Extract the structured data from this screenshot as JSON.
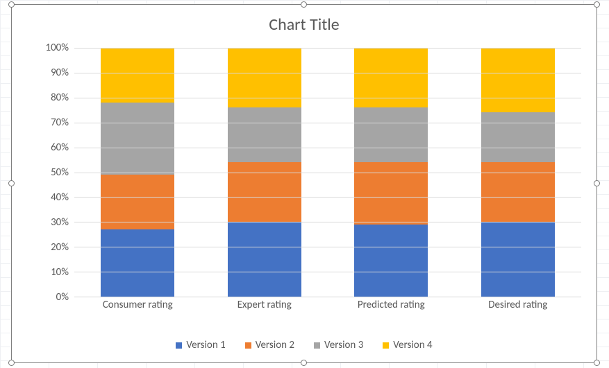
{
  "chart_data": {
    "type": "bar",
    "stacked": "percent",
    "title": "Chart Title",
    "xlabel": "",
    "ylabel": "",
    "ylim": [
      0,
      100
    ],
    "y_ticks": [
      "0%",
      "10%",
      "20%",
      "30%",
      "40%",
      "50%",
      "60%",
      "70%",
      "80%",
      "90%",
      "100%"
    ],
    "categories": [
      "Consumer rating",
      "Expert rating",
      "Predicted rating",
      "Desired rating"
    ],
    "series": [
      {
        "name": "Version 1",
        "color": "#4472C4",
        "values": [
          27,
          30,
          29,
          30
        ]
      },
      {
        "name": "Version 2",
        "color": "#ED7D31",
        "values": [
          22,
          24,
          25,
          24
        ]
      },
      {
        "name": "Version 3",
        "color": "#A5A5A5",
        "values": [
          29,
          22,
          22,
          20
        ]
      },
      {
        "name": "Version 4",
        "color": "#FFC000",
        "values": [
          22,
          24,
          24,
          26
        ]
      }
    ]
  }
}
